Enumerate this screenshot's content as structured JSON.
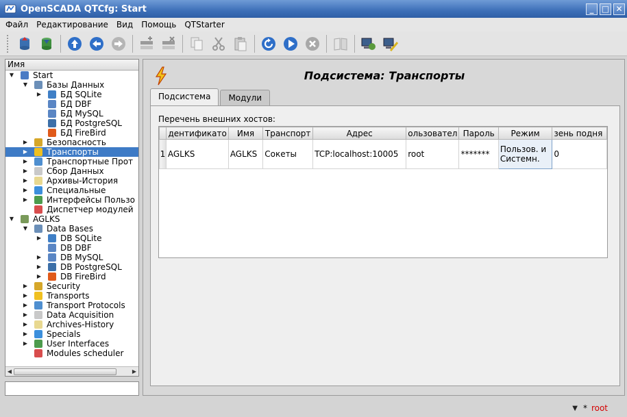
{
  "window": {
    "title": "OpenSCADA QTCfg: Start"
  },
  "menu": [
    {
      "label": "Файл"
    },
    {
      "label": "Редактирование"
    },
    {
      "label": "Вид"
    },
    {
      "label": "Помощь"
    },
    {
      "label": "QTStarter"
    }
  ],
  "tree": {
    "header": "Имя",
    "rows": [
      {
        "label": "Start",
        "depth": 0,
        "expander": "open",
        "icon": "station-icon",
        "color": "#4a7bc4"
      },
      {
        "label": "Базы Данных",
        "depth": 1,
        "expander": "open",
        "icon": "database-icon",
        "color": "#6b8fb8"
      },
      {
        "label": "БД SQLite",
        "depth": 2,
        "expander": "closed",
        "icon": "db-sqlite-icon",
        "color": "#3f7fc6"
      },
      {
        "label": "БД DBF",
        "depth": 2,
        "expander": "none",
        "icon": "db-dbf-icon",
        "color": "#5a86c4"
      },
      {
        "label": "БД MySQL",
        "depth": 2,
        "expander": "none",
        "icon": "db-mysql-icon",
        "color": "#5a86c4"
      },
      {
        "label": "БД PostgreSQL",
        "depth": 2,
        "expander": "none",
        "icon": "db-postgresql-icon",
        "color": "#3c6fa8"
      },
      {
        "label": "БД FireBird",
        "depth": 2,
        "expander": "none",
        "icon": "db-firebird-icon",
        "color": "#e05a1a"
      },
      {
        "label": "Безопасность",
        "depth": 1,
        "expander": "closed",
        "icon": "security-icon",
        "color": "#d6a72a"
      },
      {
        "label": "Транспорты",
        "depth": 1,
        "expander": "closed",
        "icon": "transport-icon",
        "color": "#f0c020",
        "selected": true
      },
      {
        "label": "Транспортные Прот",
        "depth": 1,
        "expander": "closed",
        "icon": "protocol-icon",
        "color": "#4f8fd0"
      },
      {
        "label": "Сбор Данных",
        "depth": 1,
        "expander": "closed",
        "icon": "daq-icon",
        "color": "#c9c9c9"
      },
      {
        "label": "Архивы-История",
        "depth": 1,
        "expander": "closed",
        "icon": "archive-icon",
        "color": "#e8d890"
      },
      {
        "label": "Специальные",
        "depth": 1,
        "expander": "closed",
        "icon": "special-icon",
        "color": "#3c8fdc"
      },
      {
        "label": "Интерфейсы Пользо",
        "depth": 1,
        "expander": "closed",
        "icon": "ui-icon",
        "color": "#4d9b4d"
      },
      {
        "label": "Диспетчер модулей",
        "depth": 1,
        "expander": "none",
        "icon": "modules-icon",
        "color": "#d84d4d"
      },
      {
        "label": "AGLKS",
        "depth": 0,
        "expander": "open",
        "icon": "station-icon",
        "color": "#7a9a5a"
      },
      {
        "label": "Data Bases",
        "depth": 1,
        "expander": "open",
        "icon": "database-icon",
        "color": "#6b8fb8"
      },
      {
        "label": "DB SQLite",
        "depth": 2,
        "expander": "closed",
        "icon": "db-sqlite-icon",
        "color": "#3f7fc6"
      },
      {
        "label": "DB DBF",
        "depth": 2,
        "expander": "none",
        "icon": "db-dbf-icon",
        "color": "#5a86c4"
      },
      {
        "label": "DB MySQL",
        "depth": 2,
        "expander": "closed",
        "icon": "db-mysql-icon",
        "color": "#5a86c4"
      },
      {
        "label": "DB PostgreSQL",
        "depth": 2,
        "expander": "closed",
        "icon": "db-postgresql-icon",
        "color": "#3c6fa8"
      },
      {
        "label": "DB FireBird",
        "depth": 2,
        "expander": "closed",
        "icon": "db-firebird-icon",
        "color": "#e05a1a"
      },
      {
        "label": "Security",
        "depth": 1,
        "expander": "closed",
        "icon": "security-icon",
        "color": "#d6a72a"
      },
      {
        "label": "Transports",
        "depth": 1,
        "expander": "closed",
        "icon": "transport-icon",
        "color": "#f0c020"
      },
      {
        "label": "Transport Protocols",
        "depth": 1,
        "expander": "closed",
        "icon": "protocol-icon",
        "color": "#4f8fd0"
      },
      {
        "label": "Data Acquisition",
        "depth": 1,
        "expander": "closed",
        "icon": "daq-icon",
        "color": "#c9c9c9"
      },
      {
        "label": "Archives-History",
        "depth": 1,
        "expander": "closed",
        "icon": "archive-icon",
        "color": "#e8d890"
      },
      {
        "label": "Specials",
        "depth": 1,
        "expander": "closed",
        "icon": "special-icon",
        "color": "#3c8fdc"
      },
      {
        "label": "User Interfaces",
        "depth": 1,
        "expander": "closed",
        "icon": "ui-icon",
        "color": "#4d9b4d"
      },
      {
        "label": "Modules scheduler",
        "depth": 1,
        "expander": "none",
        "icon": "modules-icon",
        "color": "#d84d4d"
      }
    ]
  },
  "page": {
    "title": "Подсистема: Транспорты",
    "tabs": [
      {
        "label": "Подсистема",
        "active": true
      },
      {
        "label": "Модули",
        "active": false
      }
    ],
    "hosts_label": "Перечень внешних хостов:",
    "table": {
      "columns": [
        "Идентификатор",
        "Имя",
        "Транспорт",
        "Адрес",
        "Пользователь",
        "Пароль",
        "Режим",
        "Время поднятия"
      ],
      "column_headers_visible": [
        "дентификато",
        "Имя",
        "Транспорт",
        "Адрес",
        "ользовател",
        "Пароль",
        "Режим",
        "зень подня"
      ],
      "rows": [
        {
          "num": "1",
          "cells": [
            "AGLKS",
            "AGLKS",
            "Сокеты",
            "TCP:localhost:10005",
            "root",
            "*******",
            "Пользов. и Системн.",
            "0"
          ]
        }
      ]
    }
  },
  "status": {
    "marker": "*",
    "user": "root"
  },
  "colors": {
    "titlebar": "#3d6fb8",
    "selection": "#3e7bc6",
    "user_status": "#d40000"
  }
}
